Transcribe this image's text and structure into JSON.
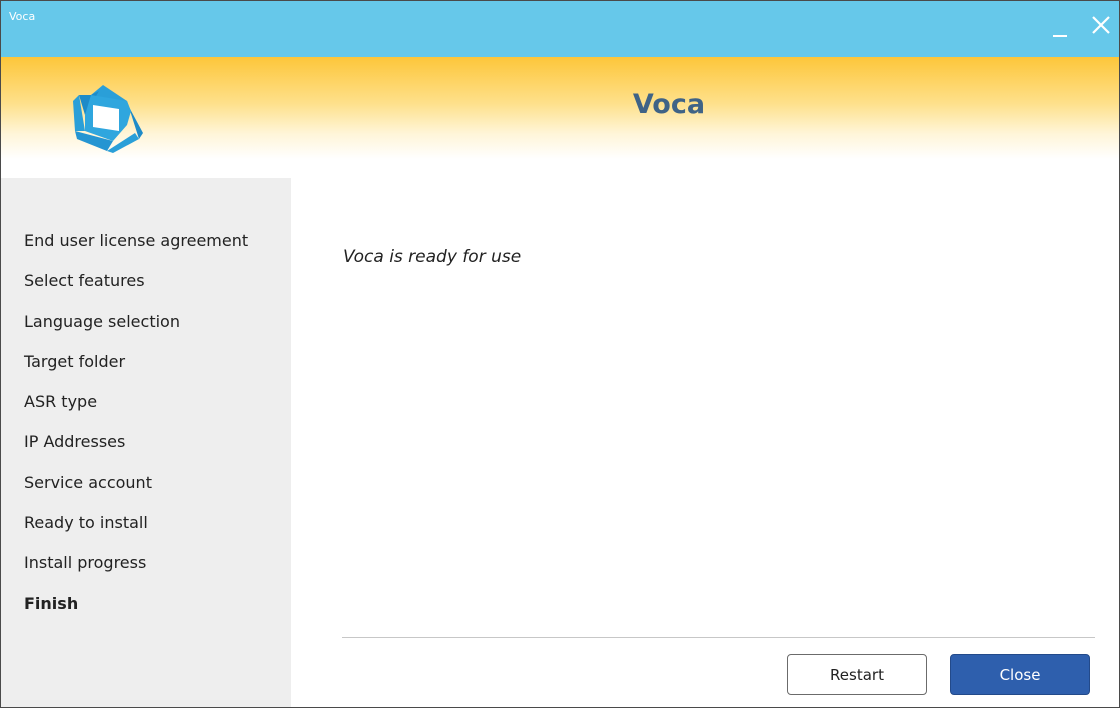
{
  "window": {
    "title": "Voca"
  },
  "header": {
    "title": "Voca",
    "logo_icon": "voca-logo-icon"
  },
  "sidebar": {
    "steps": [
      {
        "label": "End user license agreement",
        "active": false
      },
      {
        "label": "Select features",
        "active": false
      },
      {
        "label": "Language selection",
        "active": false
      },
      {
        "label": "Target folder",
        "active": false
      },
      {
        "label": "ASR type",
        "active": false
      },
      {
        "label": "IP Addresses",
        "active": false
      },
      {
        "label": "Service account",
        "active": false
      },
      {
        "label": "Ready to install",
        "active": false
      },
      {
        "label": "Install progress",
        "active": false
      },
      {
        "label": "Finish",
        "active": true
      }
    ]
  },
  "main": {
    "message": "Voca is ready for use"
  },
  "buttons": {
    "restart_label": "Restart",
    "close_label": "Close"
  },
  "colors": {
    "titlebar": "#66c8ea",
    "header_gradient_top": "#fdc63a",
    "header_title": "#3f6386",
    "logo": "#2a9fd8",
    "primary_button": "#2e5fad"
  }
}
